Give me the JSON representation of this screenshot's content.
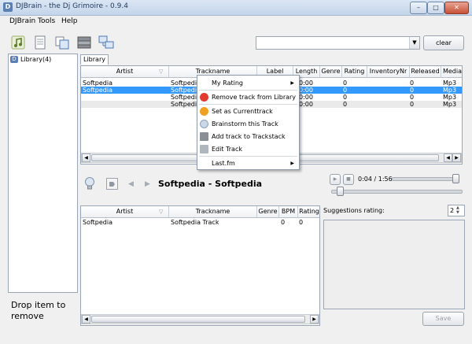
{
  "window": {
    "title": "DJBrain - the Dj Grimoire - 0.9.4",
    "app_icon": "D"
  },
  "window_buttons": {
    "minimize": "–",
    "maximize": "□",
    "close": "✕"
  },
  "menu": [
    "DJBrain",
    "Tools",
    "Help"
  ],
  "toolbar": {
    "icons": [
      "music-note-icon",
      "document-icon",
      "copy-icon",
      "database-icon",
      "network-icon"
    ],
    "search_value": "",
    "clear_label": "clear"
  },
  "library_tree": {
    "item": "Library(4)"
  },
  "drop_text": "Drop item to remove",
  "tab_label": "Library",
  "library_table": {
    "columns": [
      "Artist",
      "Trackname",
      "Label",
      "Length",
      "Genre",
      "Rating",
      "InventoryNr",
      "Released",
      "Media"
    ],
    "rows": [
      {
        "artist": "Softpedia",
        "track": "Softpedia",
        "length": "0:00",
        "genre": "",
        "rating": "0",
        "inventory": "",
        "released": "0",
        "media": "Mp3"
      },
      {
        "artist": "Softpedia",
        "track": "Softpedia",
        "length": "0:00",
        "genre": "",
        "rating": "0",
        "inventory": "",
        "released": "0",
        "media": "Mp3"
      },
      {
        "artist": "",
        "track": "Softpedia",
        "length": "0:00",
        "genre": "",
        "rating": "0",
        "inventory": "",
        "released": "0",
        "media": "Mp3"
      },
      {
        "artist": "",
        "track": "Softpedia",
        "length": "0:00",
        "genre": "",
        "rating": "0",
        "inventory": "",
        "released": "0",
        "media": "Mp3"
      }
    ],
    "selected_row": 1
  },
  "context_menu": {
    "items": [
      {
        "label": "My Rating",
        "icon": "",
        "submenu": true
      },
      {
        "label": "Remove track from Library",
        "icon": "remove-icon",
        "submenu": false
      },
      {
        "label": "Set as Currenttrack",
        "icon": "set-current-icon",
        "submenu": false
      },
      {
        "label": "Brainstorm this Track",
        "icon": "lightbulb-icon",
        "submenu": false
      },
      {
        "label": "Add track to Trackstack",
        "icon": "trackstack-icon",
        "submenu": false
      },
      {
        "label": "Edit Track",
        "icon": "edit-icon",
        "submenu": false
      },
      {
        "label": "Last.fm",
        "icon": "",
        "submenu": true
      }
    ],
    "colors": {
      "remove": "#e23b2e",
      "set_current": "#f0a020",
      "brainstorm": "#c9d7e6",
      "edit": "#b0b6bd"
    }
  },
  "player": {
    "current_track": "Softpedia - Softpedia",
    "time": "0:04 / 1:56",
    "progress": 0.04
  },
  "suggestions_table": {
    "columns": [
      "Artist",
      "Trackname",
      "Genre",
      "BPM",
      "Rating"
    ],
    "rows": [
      {
        "artist": "Softpedia",
        "track": "Softpedia Track",
        "genre": "",
        "bpm": "0",
        "rating": "0"
      }
    ]
  },
  "suggestions_rating": {
    "label": "Suggestions rating:",
    "value": "2"
  },
  "save_label": "Save"
}
